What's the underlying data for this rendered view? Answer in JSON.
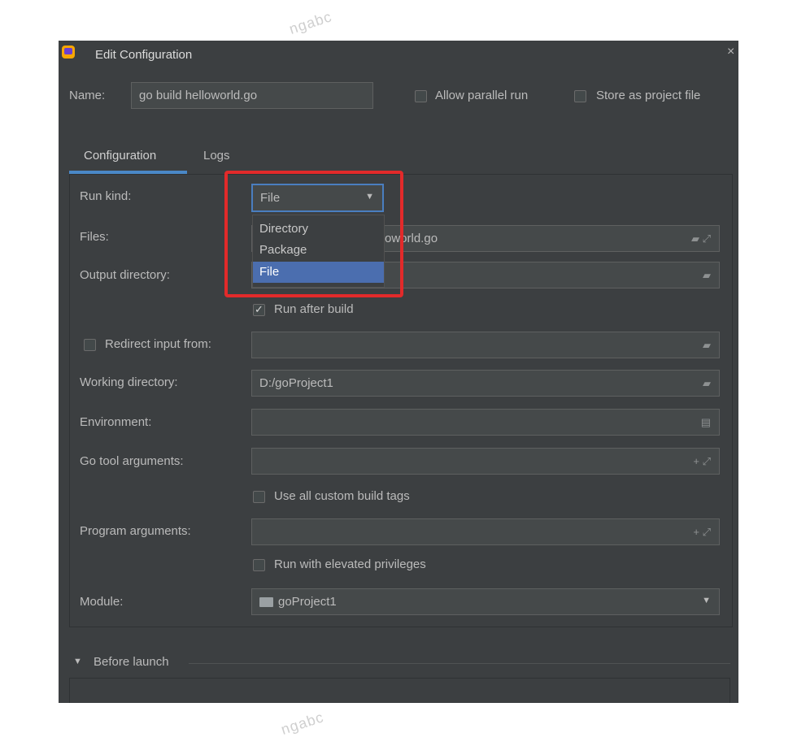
{
  "watermark": "ngabc",
  "window": {
    "title": "Edit Configuration",
    "close": "×"
  },
  "name_label": "Name:",
  "name_value": "go build helloworld.go",
  "allow_parallel": "Allow parallel run",
  "store_project": "Store as project file",
  "tabs": [
    {
      "label": "Configuration",
      "active": true
    },
    {
      "label": "Logs",
      "active": false
    }
  ],
  "fields": {
    "run_kind": {
      "label": "Run kind:",
      "value": "File"
    },
    "files": {
      "label": "Files:",
      "value": "oworld.go"
    },
    "output_dir": {
      "label": "Output directory:",
      "value": ""
    },
    "run_after_build": "Run after build",
    "redirect_input": "Redirect input from:",
    "working_dir": {
      "label": "Working directory:",
      "value": "D:/goProject1"
    },
    "environment": {
      "label": "Environment:",
      "value": ""
    },
    "go_tool_args": {
      "label": "Go tool arguments:",
      "value": ""
    },
    "use_custom_tags": "Use all custom build tags",
    "program_args": {
      "label": "Program arguments:",
      "value": ""
    },
    "run_elevated": "Run with elevated privileges",
    "module": {
      "label": "Module:",
      "value": "goProject1"
    }
  },
  "dropdown_options": [
    "Directory",
    "Package",
    "File"
  ],
  "dropdown_selected": "File",
  "before_launch": "Before launch",
  "colors": {
    "accent": "#4b6eaf",
    "highlight_box": "#e22a2a",
    "tab_underline": "#4a88c7"
  }
}
